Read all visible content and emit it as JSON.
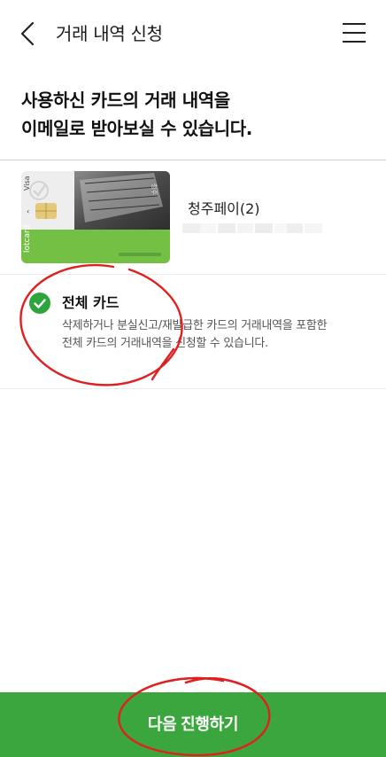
{
  "header": {
    "back_icon": "chevron-left-icon",
    "title": "거래 내역 신청",
    "menu_icon": "hamburger-menu-icon"
  },
  "headline": {
    "line1": "사용하신 카드의 거래 내역을",
    "line2": "이메일로 받아보실 수 있습니다."
  },
  "card": {
    "name": "청주페이(2)",
    "number_masked": true,
    "image_colors": {
      "top": "#e9e9e9",
      "bottom": "#74c045",
      "photo": "#5a5a5a"
    },
    "image_side_text": "Visa",
    "image_brand_text": "lotcard"
  },
  "option": {
    "check_icon": "check-circle-icon",
    "selected": true,
    "title": "전체 카드",
    "desc_line1": "삭제하거나 분실신고/재발급한 카드의 거래내역을 포함한",
    "desc_line2": "전체 카드의 거래내역을 신청할 수 있습니다."
  },
  "footer": {
    "next_label": "다음 진행하기"
  },
  "colors": {
    "accent": "#3aa63d",
    "check": "#2fa33c",
    "annotation": "#e02020"
  }
}
